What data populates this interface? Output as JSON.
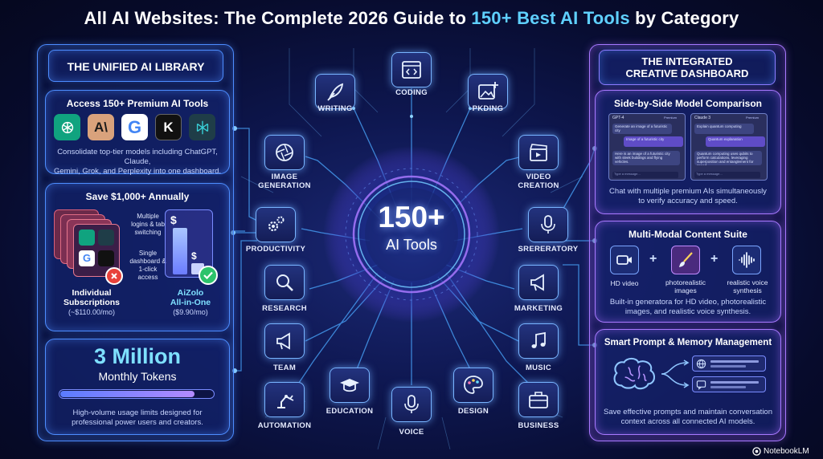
{
  "title": {
    "part1": "All AI Websites: The Complete 2026 Guide to ",
    "highlight1": "150+",
    "part2": " ",
    "highlight2": "Best AI Tools",
    "part3": " by Category"
  },
  "left_panel": {
    "header": "THE UNIFIED AI LIBRARY",
    "access": {
      "heading": "Access 150+ Premium AI Tools",
      "logos": [
        "chatgpt-logo",
        "anthropic-logo",
        "google-logo",
        "grok-logo",
        "perplexity-logo"
      ],
      "anthropic_text": "A\\",
      "google_text": "G",
      "grok_text": "K",
      "description_line1": "Consolidate top-tier models including ChatGPT, Claude,",
      "description_line2": "Gemini, Grok, and Perplexity into one dashboard."
    },
    "savings": {
      "heading": "Save $1,000+ Annually",
      "multiple_note_line1": "Multiple",
      "multiple_note_line2": "logins & tab",
      "multiple_note_line3": "switching",
      "single_note_line1": "Single",
      "single_note_line2": "dashboard &",
      "single_note_line3": "1-click",
      "single_note_line4": "access",
      "individual_label_line1": "Individual",
      "individual_label_line2": "Subscriptions",
      "individual_price": "(~$110.00/mo)",
      "aizolo_label_line1": "AiZolo",
      "aizolo_label_line2": "All-in-One",
      "aizolo_price": "($9.90/mo)",
      "dollar_sign": "$"
    },
    "tokens": {
      "big": "3 Million",
      "sub": "Monthly Tokens",
      "progress": 0.88,
      "description_line1": "High-volume usage limits designed for",
      "description_line2": "professional power users and creators."
    }
  },
  "center": {
    "hub_big": "150+",
    "hub_sub": "AI Tools",
    "nodes": [
      {
        "id": "writing",
        "label": "WRITING",
        "icon": "feather-icon"
      },
      {
        "id": "coding",
        "label": "CODING",
        "icon": "code-window-icon"
      },
      {
        "id": "pkding",
        "label": "PKDING",
        "icon": "image-plus-icon"
      },
      {
        "id": "image-generation",
        "label_line1": "IMAGE",
        "label_line2": "GENERATION",
        "icon": "aperture-icon"
      },
      {
        "id": "video-creation",
        "label_line1": "VIDEO",
        "label_line2": "CREATION",
        "icon": "clapperboard-icon"
      },
      {
        "id": "productivity",
        "label": "PRODUCTIVITY",
        "icon": "gears-icon"
      },
      {
        "id": "srereatory",
        "label": "SRERERATORY",
        "icon": "microphone-icon"
      },
      {
        "id": "research",
        "label": "RESEARCH",
        "icon": "magnifier-icon"
      },
      {
        "id": "marketing",
        "label": "MARKETING",
        "icon": "megaphone-icon"
      },
      {
        "id": "team",
        "label": "TEAM",
        "icon": "megaphone-icon"
      },
      {
        "id": "music",
        "label": "MUSIC",
        "icon": "music-note-icon"
      },
      {
        "id": "automation",
        "label": "AUTOMATION",
        "icon": "robot-arm-icon"
      },
      {
        "id": "education",
        "label": "EDUCATION",
        "icon": "graduation-cap-icon"
      },
      {
        "id": "voice",
        "label": "VOICE",
        "icon": "microphone-icon"
      },
      {
        "id": "design",
        "label": "DESIGN",
        "icon": "palette-icon"
      },
      {
        "id": "business",
        "label": "BUSINESS",
        "icon": "briefcase-icon"
      }
    ]
  },
  "right_panel": {
    "header_line1": "THE INTEGRATED",
    "header_line2": "CREATIVE DASHBOARD",
    "comparison": {
      "heading": "Side-by-Side Model Comparison",
      "left_model": "GPT-4",
      "right_model": "Claude 3",
      "left_tag": "Premium",
      "right_tag": "Premium",
      "left_prompt": "Generate an image of a futuristic city",
      "left_reply_1": "Image of a futuristic city",
      "left_reply_2": "Here is an image of a futuristic city with sleek buildings and flying vehicles.",
      "right_prompt": "Explain quantum computing",
      "right_reply_1": "Quantum explanation",
      "right_reply_2": "Quantum computing uses qubits to perform calculations, leveraging superposition and entanglement for speed.",
      "input_placeholder": "Type a message...",
      "description_line1": "Chat with multiple premium AIs simultaneously",
      "description_line2": "to verify accuracy and speed."
    },
    "multimodal": {
      "heading": "Multi-Modal Content Suite",
      "items": [
        {
          "label": "HD video",
          "icon": "video-camera-icon"
        },
        {
          "label_line1": "photorealistic",
          "label_line2": "images",
          "icon": "paintbrush-icon"
        },
        {
          "label_line1": "realistic voice",
          "label_line2": "synthesis",
          "icon": "waveform-icon"
        }
      ],
      "plus": "+",
      "description_line1": "Built-in generatora for HD video, photorealistic",
      "description_line2": "images, and realistic voice synthesis."
    },
    "memory": {
      "heading": "Smart Prompt & Memory Management",
      "description_line1": "Save effective prompts and maintain conversation",
      "description_line2": "context across all connected AI models."
    }
  },
  "watermark": "NotebookLM",
  "colors": {
    "accent_cyan": "#5fd0ff",
    "panel_border": "#4d8dff",
    "purple": "#a879ff",
    "red_x": "#e8423b",
    "green_check": "#2cc36b"
  }
}
